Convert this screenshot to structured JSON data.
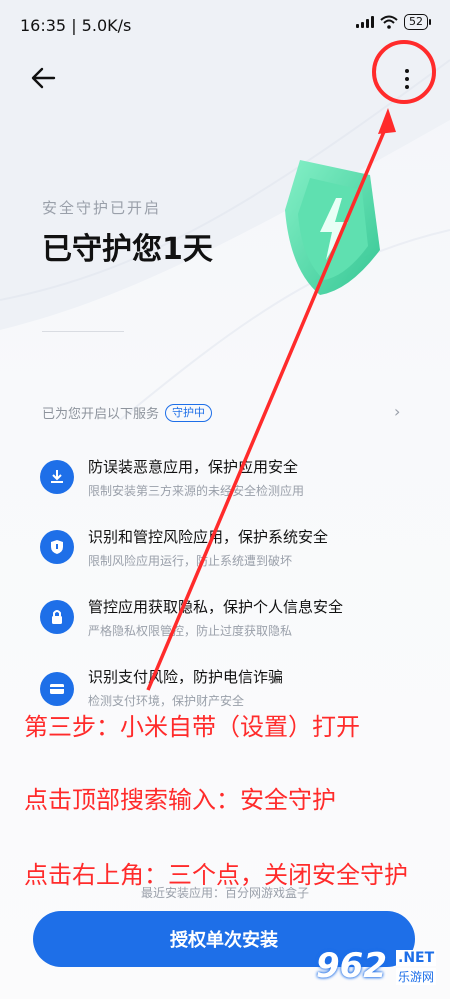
{
  "status_bar": {
    "time_speed": "16:35 | 5.0K/s",
    "battery": "52"
  },
  "hero": {
    "subtitle": "安全守护已开启",
    "title": "已守护您1天"
  },
  "services": {
    "header": "已为您开启以下服务",
    "badge": "守护中",
    "items": [
      {
        "title": "防误装恶意应用，保护应用安全",
        "desc": "限制安装第三方来源的未经安全检测应用",
        "icon": "download-shield-icon"
      },
      {
        "title": "识别和管控风险应用，保护系统安全",
        "desc": "限制风险应用运行，防止系统遭到破坏",
        "icon": "shield-icon"
      },
      {
        "title": "管控应用获取隐私，保护个人信息安全",
        "desc": "严格隐私权限管控，防止过度获取隐私",
        "icon": "lock-icon"
      },
      {
        "title": "识别支付风险，防护电信诈骗",
        "desc": "检测支付环境，保护财产安全",
        "icon": "card-icon"
      }
    ]
  },
  "recent_install": "最近安装应用：百分网游戏盒子",
  "install_button": "授权单次安装",
  "annotations": {
    "step": "第三步：小米自带（设置）打开",
    "search": "点击顶部搜索输入：安全守护",
    "close": "点击右上角：三个点，关闭安全守护"
  },
  "watermark": {
    "number": "962",
    "net": ".NET",
    "site": "乐游网"
  },
  "colors": {
    "accent": "#1e6fe8",
    "annotation": "#ff2b2b",
    "shield": "#4ed6a4"
  }
}
